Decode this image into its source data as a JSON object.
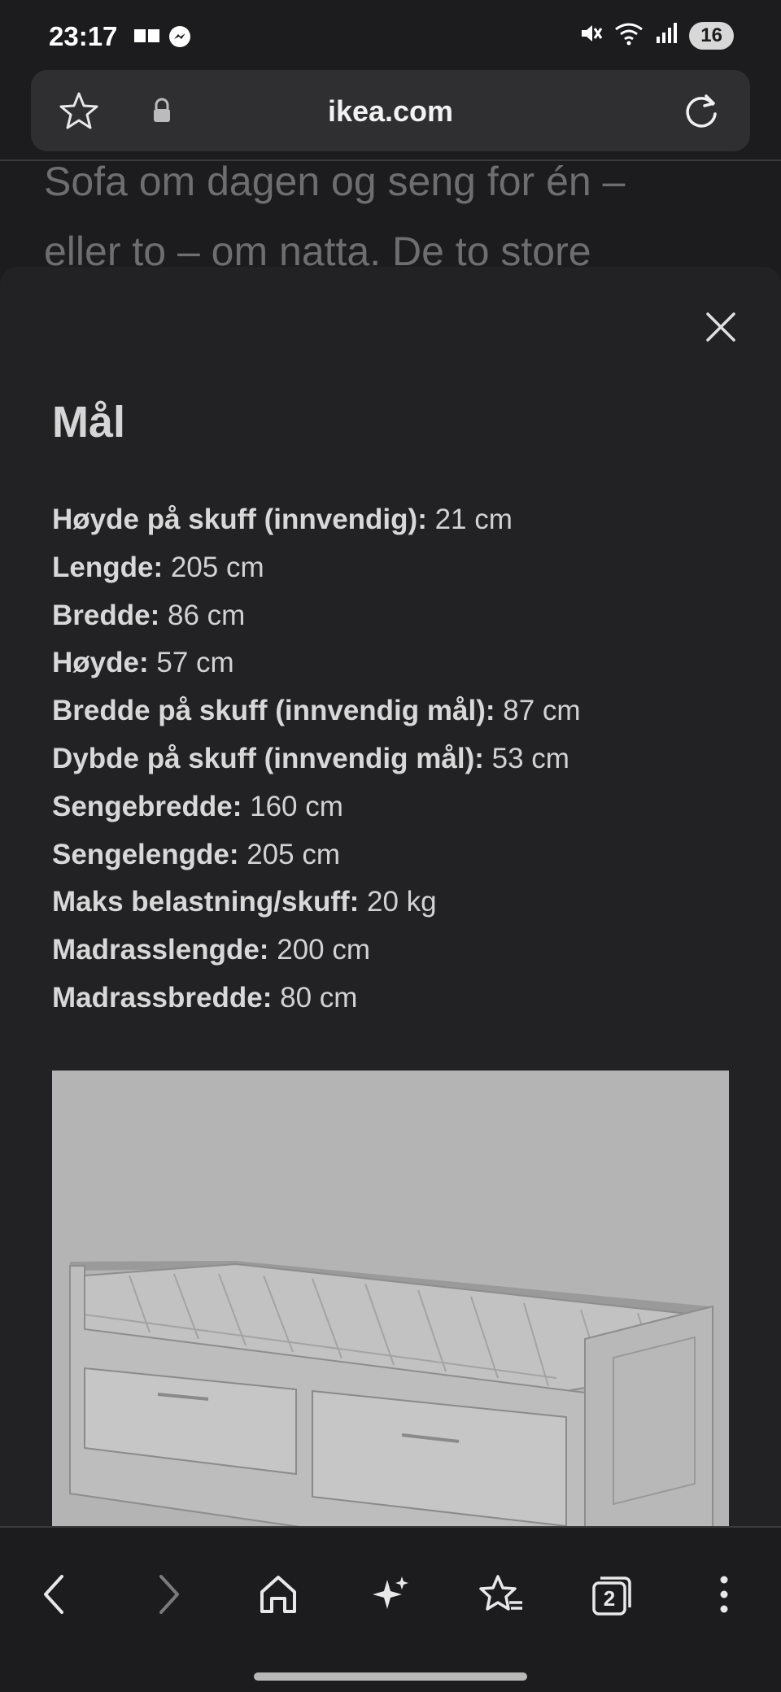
{
  "status_bar": {
    "time": "23:17",
    "battery": "16",
    "left_icons": [
      "sim-icon",
      "messenger-icon"
    ],
    "right_icons": [
      "mute-icon",
      "wifi-icon",
      "signal-icon"
    ]
  },
  "browser": {
    "url": "ikea.com",
    "icons": [
      "star-icon",
      "lock-icon",
      "reload-icon"
    ]
  },
  "background_page": {
    "text_line1": "Sofa om dagen og seng for én –",
    "text_line2": "eller to – om natta. De to store"
  },
  "sheet": {
    "title": "Mål",
    "dimensions": [
      {
        "label": "Høyde på skuff (innvendig):",
        "value": " 21 cm"
      },
      {
        "label": "Lengde:",
        "value": " 205 cm"
      },
      {
        "label": "Bredde:",
        "value": " 86 cm"
      },
      {
        "label": "Høyde:",
        "value": " 57 cm"
      },
      {
        "label": "Bredde på skuff (innvendig mål):",
        "value": " 87 cm"
      },
      {
        "label": "Dybde på skuff (innvendig mål):",
        "value": " 53 cm"
      },
      {
        "label": "Sengebredde:",
        "value": " 160 cm"
      },
      {
        "label": "Sengelengde:",
        "value": " 205 cm"
      },
      {
        "label": "Maks belastning/skuff:",
        "value": " 20 kg"
      },
      {
        "label": "Madrasslengde:",
        "value": " 200 cm"
      },
      {
        "label": "Madrassbredde:",
        "value": " 80 cm"
      }
    ]
  },
  "bottom_nav": {
    "tab_count": "2",
    "icons": [
      "back-icon",
      "forward-icon",
      "home-icon",
      "sparkle-icon",
      "bookmarks-icon",
      "tabs-icon",
      "more-icon"
    ]
  }
}
